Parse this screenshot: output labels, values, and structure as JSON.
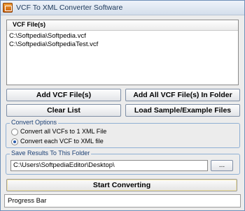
{
  "window": {
    "title": "VCF To XML Converter Software"
  },
  "file_list": {
    "header": "VCF File(s)",
    "items": [
      "C:\\Softpedia\\Softpedia.vcf",
      "C:\\Softpedia\\SoftpediaTest.vcf"
    ]
  },
  "buttons": {
    "add_files": "Add VCF File(s)",
    "add_folder": "Add All VCF File(s) In Folder",
    "clear_list": "Clear List",
    "load_sample": "Load Sample/Example Files",
    "browse": "...",
    "start": "Start Converting"
  },
  "convert_options": {
    "label": "Convert Options",
    "options": [
      "Convert all VCFs to 1 XML File",
      "Convert each VCF to XML file"
    ],
    "selected_index": 1
  },
  "save_results": {
    "label": "Save Results To This Folder",
    "path": "C:\\Users\\SoftpediaEditor\\Desktop\\"
  },
  "progress": {
    "text": "Progress Bar"
  }
}
